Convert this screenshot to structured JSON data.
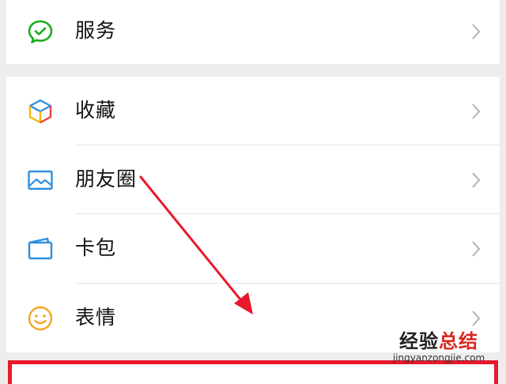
{
  "menu": {
    "services": {
      "label": "服务",
      "icon": "chat-check-icon",
      "color": "#1aad19"
    },
    "favorites": {
      "label": "收藏",
      "icon": "cube-icon"
    },
    "moments": {
      "label": "朋友圈",
      "icon": "picture-icon",
      "color": "#2d8fe0"
    },
    "cards": {
      "label": "卡包",
      "icon": "wallet-icon",
      "color": "#2d8fe0"
    },
    "stickers": {
      "label": "表情",
      "icon": "smiley-icon",
      "color": "#f5a623"
    }
  },
  "annotation": {
    "arrow_color": "#e8192c",
    "box_color": "#e8192c"
  },
  "watermark": {
    "prefix": "经验",
    "suffix": "总结",
    "url": "jingyanzongjie.com"
  }
}
